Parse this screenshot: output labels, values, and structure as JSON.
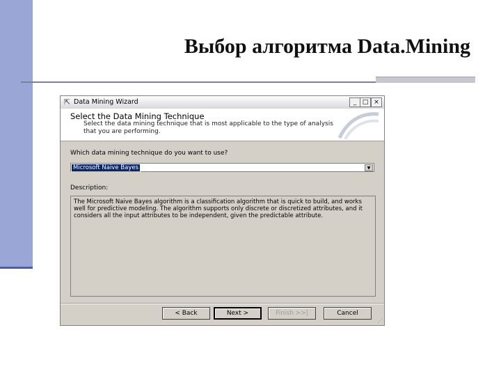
{
  "slide": {
    "title": "Выбор алгоритма Data.Mining"
  },
  "window": {
    "title": "Data Mining Wizard",
    "controls": [
      "_",
      "□",
      "×"
    ]
  },
  "header": {
    "title": "Select the Data Mining Technique",
    "subtitle": "Select the data mining technique that is most applicable to the type of analysis that you are performing."
  },
  "question": {
    "label": "Which data mining technique do you want to use?",
    "selected": "Microsoft Naive Bayes"
  },
  "description": {
    "label": "Description:",
    "text": "The Microsoft Naive Bayes algorithm is a classification algorithm that is quick to build, and works well for predictive modeling. The algorithm supports only discrete or discretized attributes, and it considers all the input attributes to be independent, given the predictable attribute."
  },
  "buttons": {
    "back": "< Back",
    "next": "Next >",
    "finish": "Finish >>|",
    "cancel": "Cancel"
  },
  "colors": {
    "slide_bar": "#9aa6d6",
    "selection": "#0a246a",
    "dialog_bg": "#d4d0c8"
  }
}
